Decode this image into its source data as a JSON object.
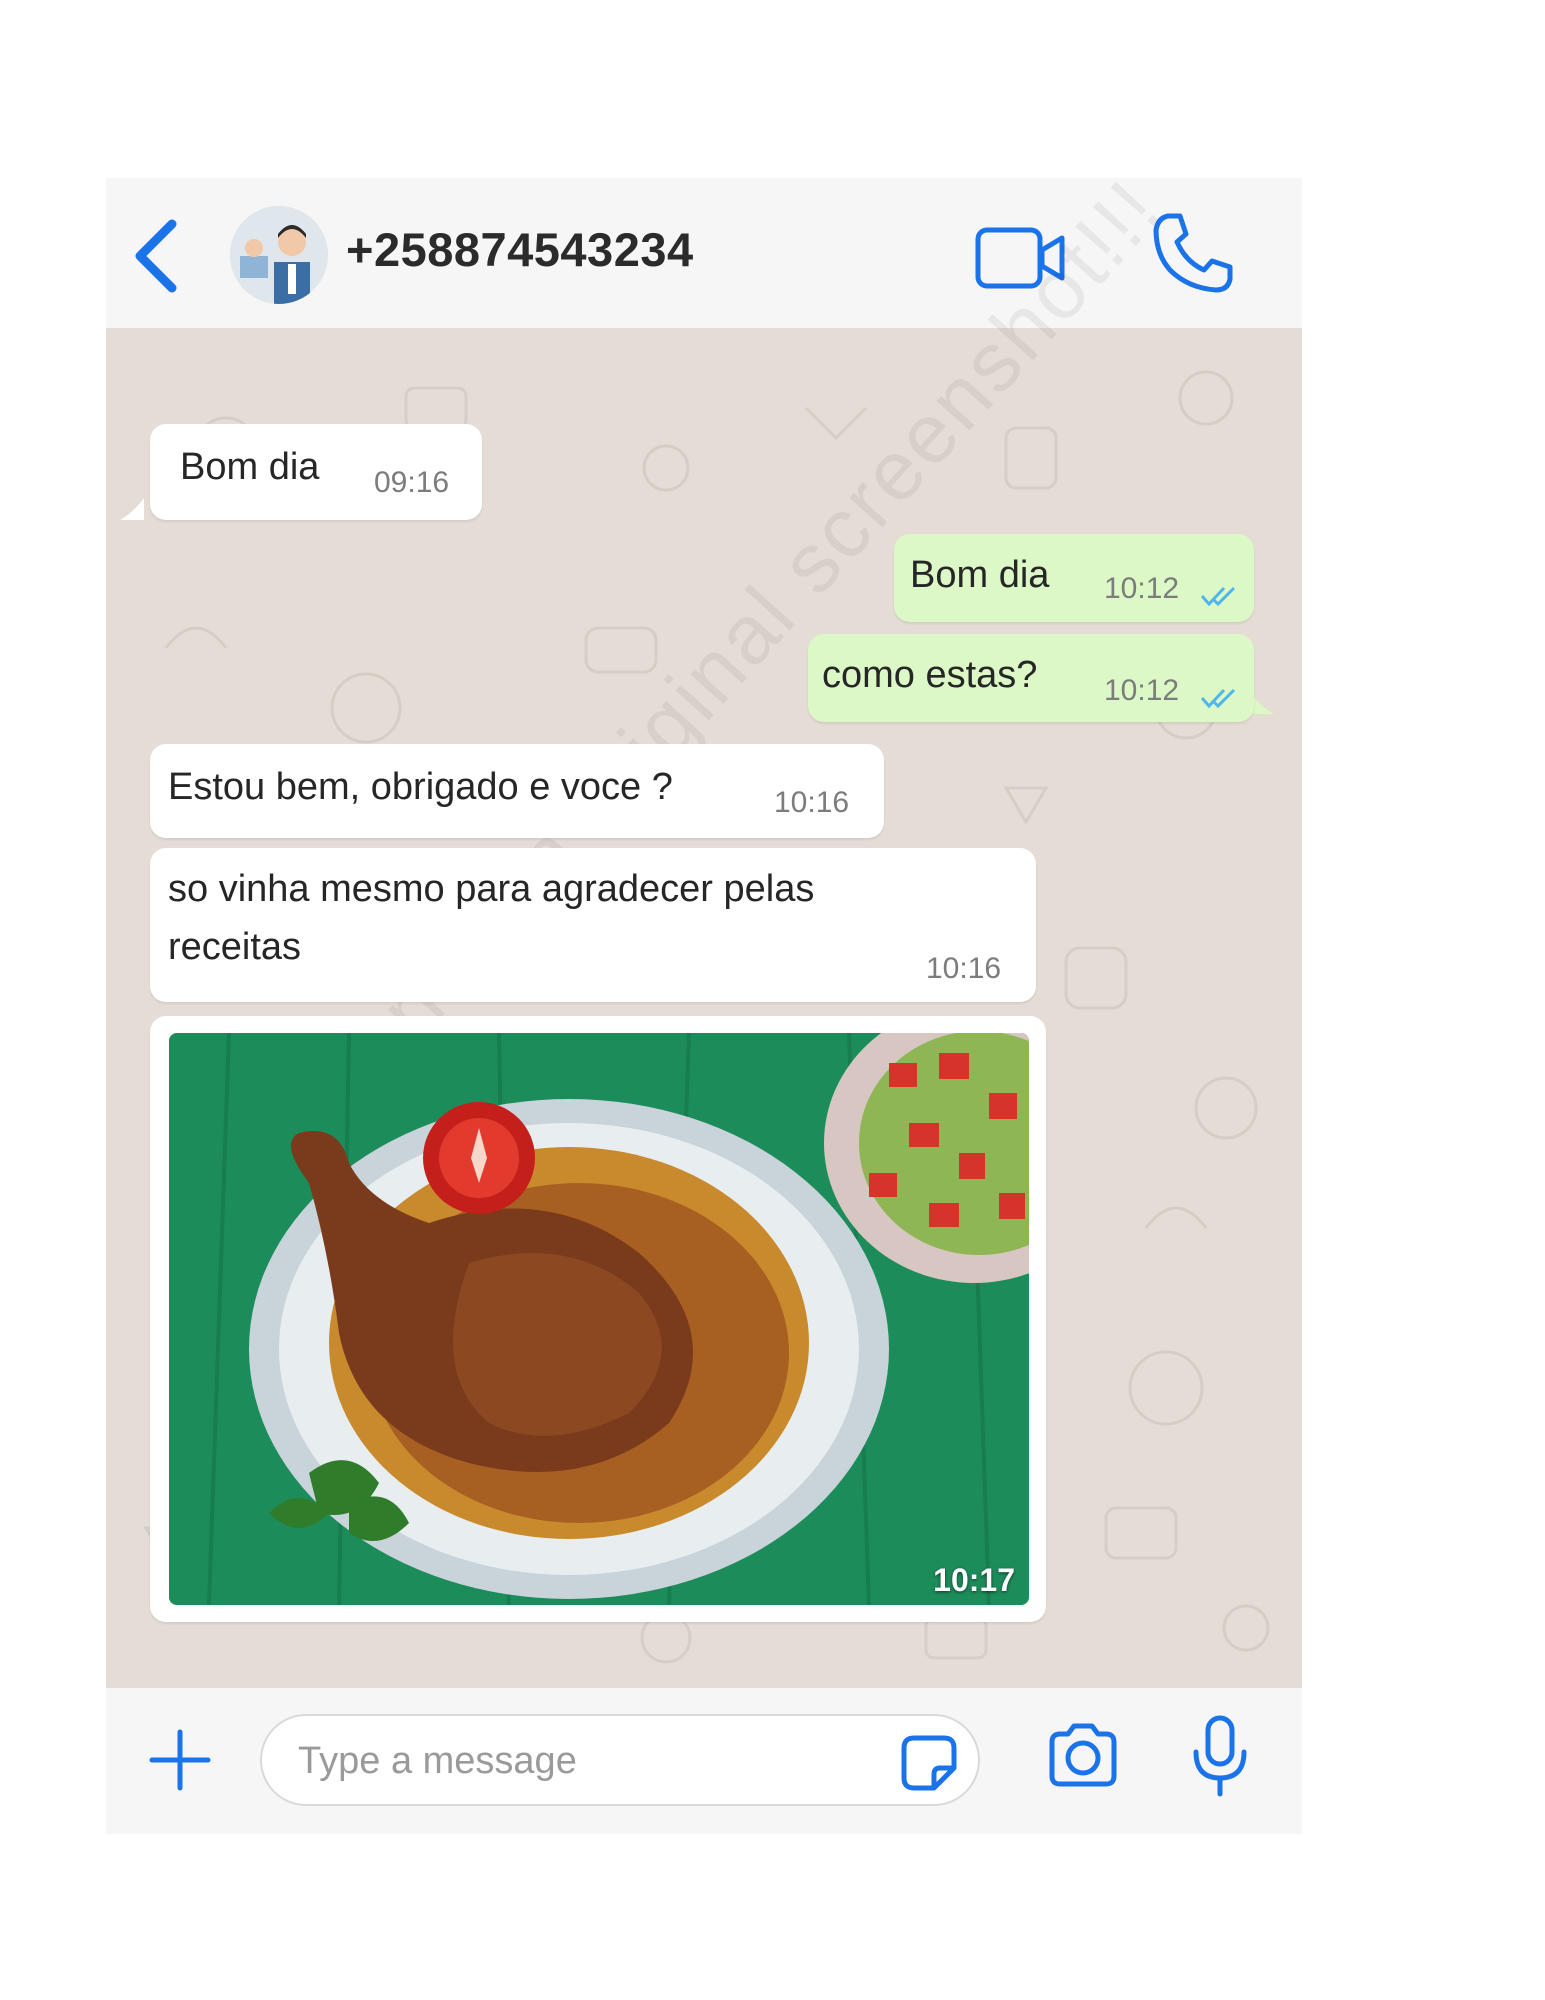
{
  "header": {
    "contact_name": "+258874543234",
    "icons": {
      "back": "back-chevron-icon",
      "video": "video-camera-icon",
      "call": "phone-icon"
    },
    "accent_color": "#1a73e8"
  },
  "messages": [
    {
      "direction": "incoming",
      "text": "Bom dia",
      "time": "09:16"
    },
    {
      "direction": "outgoing",
      "text": "Bom dia",
      "time": "10:12",
      "status": "read"
    },
    {
      "direction": "outgoing",
      "text": "como estas?",
      "time": "10:12",
      "status": "read"
    },
    {
      "direction": "incoming",
      "text": "Estou bem, obrigado e voce ?",
      "time": "10:16"
    },
    {
      "direction": "incoming",
      "text_line1": "so vinha mesmo para agradecer pelas",
      "text_line2": "receitas",
      "time": "10:16"
    },
    {
      "direction": "incoming",
      "type": "image",
      "image_subject": "roast-chicken-plate-photo",
      "time": "10:17"
    }
  ],
  "watermark": "This is not an original screenshot!!!",
  "composer": {
    "placeholder": "Type a message",
    "icons": {
      "add": "plus-icon",
      "sticker": "sticker-icon",
      "camera": "camera-icon",
      "mic": "microphone-icon"
    }
  },
  "colors": {
    "incoming_bubble": "#ffffff",
    "outgoing_bubble": "#dcf8c6",
    "chat_background": "#e5ddd5",
    "read_ticks": "#4fb6ec"
  }
}
